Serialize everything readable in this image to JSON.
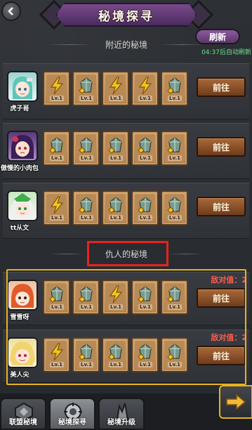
{
  "header": {
    "title": "秘境探寻",
    "refresh_label": "刷新",
    "refresh_note": "04:37后自动刷新"
  },
  "sections": {
    "nearby_title": "附近的秘境",
    "enemy_title": "仇人的秘境"
  },
  "nearby_rows": [
    {
      "name": "虎子哥",
      "go_label": "前往",
      "cards": [
        "bolt",
        "crystal",
        "bolt",
        "bolt",
        "crystal"
      ]
    },
    {
      "name": "傲慢的小肉包",
      "go_label": "前往",
      "cards": [
        "crystal",
        "crystal",
        "crystal",
        "crystal",
        "crystal"
      ]
    },
    {
      "name": "tt从文",
      "go_label": "前往",
      "cards": [
        "bolt",
        "crystal",
        "crystal",
        "crystal",
        "crystal"
      ]
    }
  ],
  "enemy_rows": [
    {
      "name": "雪雪呀",
      "go_label": "前往",
      "enemy_value": "敌对值：2",
      "cards": [
        "crystal",
        "crystal",
        "bolt",
        "crystal",
        "crystal"
      ]
    },
    {
      "name": "美人尖",
      "go_label": "前往",
      "enemy_value": "敌对值：2",
      "cards": [
        "bolt",
        "crystal",
        "crystal",
        "crystal",
        "crystal"
      ]
    }
  ],
  "card_level": "Lv.1",
  "tabs": [
    {
      "label": "联盟秘境",
      "icon": "alliance-icon"
    },
    {
      "label": "秘境探寻",
      "icon": "explore-icon",
      "active": true
    },
    {
      "label": "秘境升级",
      "icon": "upgrade-icon"
    }
  ],
  "colors": {
    "accent_purple": "#7a4a8c",
    "button_brown": "#a8693a",
    "enemy_red": "#ff5a4a",
    "timer_green": "#6be08a",
    "highlight_yellow": "#e8b120",
    "highlight_red": "#e8231d"
  }
}
